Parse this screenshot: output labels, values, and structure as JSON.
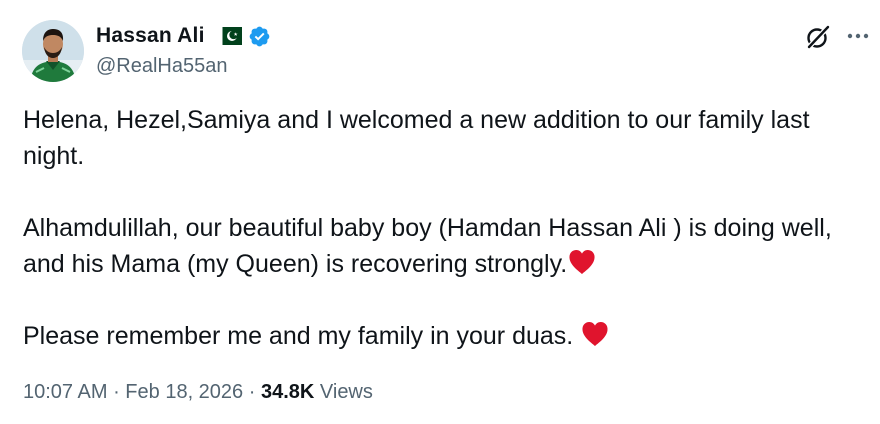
{
  "tweet": {
    "author": {
      "display_name": "Hassan Ali",
      "handle": "@RealHa55an",
      "flag_icon": "pakistan-flag-icon",
      "verified_icon": "verified-badge-icon",
      "avatar_icon": "profile-avatar"
    },
    "header_actions": {
      "grok_icon": "grok-icon",
      "more_icon": "more-options-icon"
    },
    "body": {
      "paragraph_1": "Helena, Hezel,Samiya and I welcomed a new addition to our family last night.",
      "paragraph_2": "Alhamdulillah, our beautiful baby boy (Hamdan Hassan Ali ) is doing well, and his Mama (my Queen) is recovering strongly.",
      "paragraph_3": "Please remember me and my family in your duas. ",
      "emoji_icon": "red-heart-icon"
    },
    "meta": {
      "time": "10:07 AM",
      "separator": " · ",
      "date": "Feb 18, 2026",
      "views_count": "34.8K",
      "views_label": "Views"
    }
  },
  "colors": {
    "text_primary": "#0f1419",
    "text_secondary": "#536471",
    "verified_blue": "#1d9bf0",
    "heart_red": "#e0142d",
    "flag_green": "#01411c"
  }
}
